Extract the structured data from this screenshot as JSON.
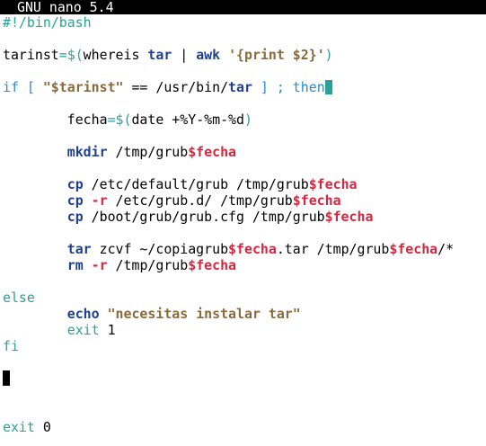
{
  "title_bar": {
    "app": "GNU nano 5.4"
  },
  "editor": {
    "shebang": "#!/bin/bash",
    "l3": {
      "a": "tarinst",
      "b": "=$(",
      "c": "whereis ",
      "d": "tar",
      "e": " | ",
      "f": "awk",
      "g": " '{print $2}'",
      "h": ")"
    },
    "l5": {
      "a": "if",
      "b": " [ ",
      "c": "\"$tarinst\"",
      "d": " == /usr/bin/",
      "e": "tar",
      "f": " ] ",
      "g": ";",
      "h": " then"
    },
    "l7": {
      "a": "fecha",
      "b": "=$(",
      "c": "date +%Y-%m-%d",
      "d": ")"
    },
    "l9": {
      "a": "mkdir",
      "b": " /tmp/grub",
      "c": "$fecha"
    },
    "l11": {
      "a": "cp",
      "b": " /etc/default/grub /tmp/grub",
      "c": "$fecha"
    },
    "l12": {
      "a": "cp",
      "b": " -r",
      "c": " /etc/grub.d/ /tmp/grub",
      "d": "$fecha"
    },
    "l13": {
      "a": "cp",
      "b": " /boot/grub/grub.cfg /tmp/grub",
      "c": "$fecha"
    },
    "l15": {
      "a": "tar",
      "b": " zcvf ~/copiagrub",
      "c": "$fecha",
      "d": ".tar /tmp/grub",
      "e": "$fecha",
      "f": "/*"
    },
    "l16": {
      "a": "rm",
      "b": " -r",
      "c": " /tmp/grub",
      "d": "$fecha"
    },
    "l18": {
      "a": "else"
    },
    "l19": {
      "a": "echo",
      "b": " \"necesitas instalar tar\""
    },
    "l20": {
      "a": "exit",
      "b": " 1"
    },
    "l21": {
      "a": "fi"
    },
    "l26": {
      "a": "exit",
      "b": " 0"
    }
  }
}
